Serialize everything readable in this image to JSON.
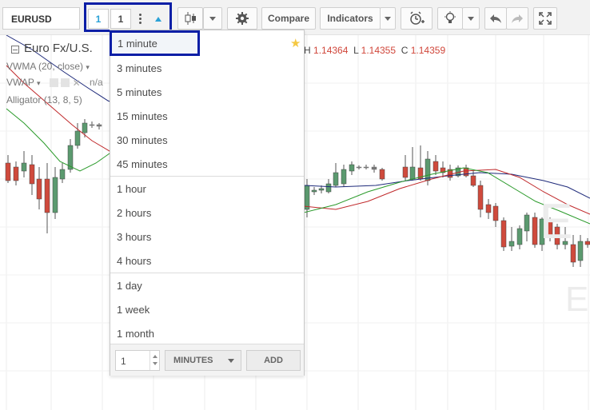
{
  "toolbar": {
    "symbol": "EURUSD",
    "interval_value_label": "1",
    "interval_input_value": "1",
    "compare_label": "Compare",
    "indicators_label": "Indicators"
  },
  "chart": {
    "title": "Euro Fx/U.S.",
    "ohlc": [
      {
        "key": "H",
        "value": "1.14364"
      },
      {
        "key": "L",
        "value": "1.14355"
      },
      {
        "key": "C",
        "value": "1.14359"
      }
    ],
    "studies": [
      {
        "label": "VWMA (20, close)"
      },
      {
        "label": "VWAP"
      },
      {
        "label": "Alligator (13, 8, 5)"
      }
    ],
    "partial_text": "n/a",
    "watermark": "E",
    "colors": {
      "up": "#5b9a6f",
      "down": "#cf4a3c",
      "vwma": "#1e2a7a",
      "jaw": "#2a9a2a",
      "teeth": "#c0292b"
    }
  },
  "dropdown": {
    "groups": [
      [
        "1 minute",
        "3 minutes",
        "5 minutes",
        "15 minutes",
        "30 minutes",
        "45 minutes"
      ],
      [
        "1 hour",
        "2 hours",
        "3 hours",
        "4 hours"
      ],
      [
        "1 day",
        "1 week",
        "1 month"
      ]
    ],
    "footer": {
      "value": "1",
      "unit": "MINUTES",
      "add_label": "ADD"
    }
  }
}
